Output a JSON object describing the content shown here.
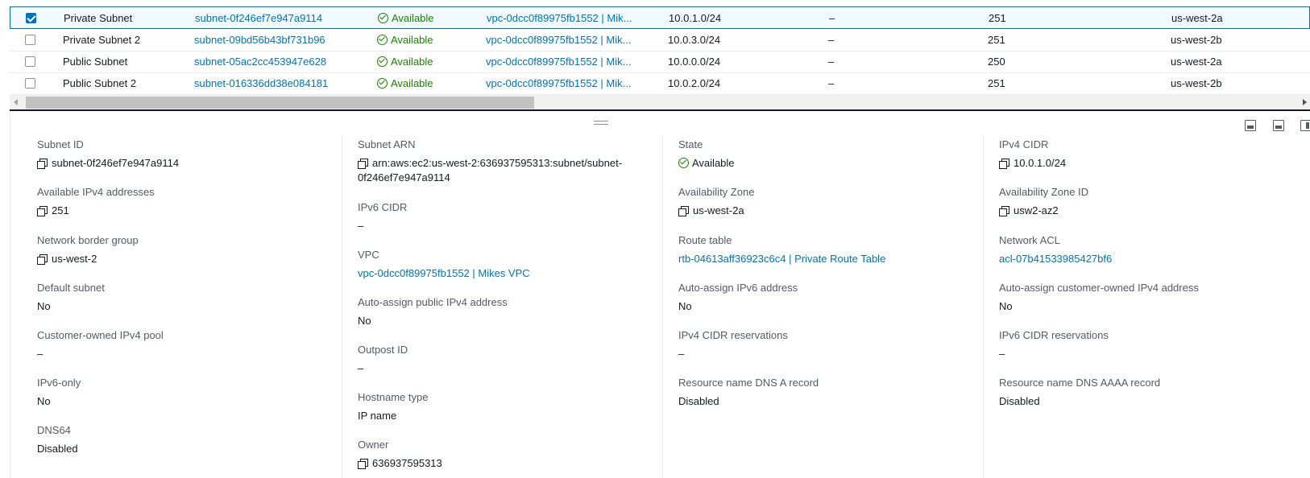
{
  "table": {
    "rows": [
      {
        "name": "Private Subnet",
        "subnet_id": "subnet-0f246ef7e947a9114",
        "state": "Available",
        "vpc": "vpc-0dcc0f89975fb1552 | Mik...",
        "cidr": "10.0.1.0/24",
        "ipv6": "–",
        "available_ips": "251",
        "az": "us-west-2a",
        "selected": true
      },
      {
        "name": "Private Subnet 2",
        "subnet_id": "subnet-09bd56b43bf731b96",
        "state": "Available",
        "vpc": "vpc-0dcc0f89975fb1552 | Mik...",
        "cidr": "10.0.3.0/24",
        "ipv6": "–",
        "available_ips": "251",
        "az": "us-west-2b",
        "selected": false
      },
      {
        "name": "Public Subnet",
        "subnet_id": "subnet-05ac2cc453947e628",
        "state": "Available",
        "vpc": "vpc-0dcc0f89975fb1552 | Mik...",
        "cidr": "10.0.0.0/24",
        "ipv6": "–",
        "available_ips": "250",
        "az": "us-west-2a",
        "selected": false
      },
      {
        "name": "Public Subnet 2",
        "subnet_id": "subnet-016336dd38e084181",
        "state": "Available",
        "vpc": "vpc-0dcc0f89975fb1552 | Mik...",
        "cidr": "10.0.2.0/24",
        "ipv6": "–",
        "available_ips": "251",
        "az": "us-west-2b",
        "selected": false
      }
    ]
  },
  "details": {
    "col1": [
      {
        "label": "Subnet ID",
        "value": "subnet-0f246ef7e947a9114",
        "copy": true
      },
      {
        "label": "Available IPv4 addresses",
        "value": "251",
        "copy": true
      },
      {
        "label": "Network border group",
        "value": "us-west-2",
        "copy": true
      },
      {
        "label": "Default subnet",
        "value": "No"
      },
      {
        "label": "Customer-owned IPv4 pool",
        "value": "–"
      },
      {
        "label": "IPv6-only",
        "value": "No"
      },
      {
        "label": "DNS64",
        "value": "Disabled"
      }
    ],
    "col2": [
      {
        "label": "Subnet ARN",
        "value": "arn:aws:ec2:us-west-2:636937595313:subnet/subnet-",
        "value2": "0f246ef7e947a9114",
        "copy": true
      },
      {
        "label": "IPv6 CIDR",
        "value": "–"
      },
      {
        "label": "VPC",
        "value": "vpc-0dcc0f89975fb1552 | Mikes VPC",
        "link": true
      },
      {
        "label": "Auto-assign public IPv4 address",
        "value": "No"
      },
      {
        "label": "Outpost ID",
        "value": "–"
      },
      {
        "label": "Hostname type",
        "value": "IP name"
      },
      {
        "label": "Owner",
        "value": "636937595313",
        "copy": true
      }
    ],
    "col3": [
      {
        "label": "State",
        "value": "Available",
        "status": true
      },
      {
        "label": "Availability Zone",
        "value": "us-west-2a",
        "copy": true
      },
      {
        "label": "Route table",
        "value": "rtb-04613aff36923c6c4 | Private Route Table",
        "link": true
      },
      {
        "label": "Auto-assign IPv6 address",
        "value": "No"
      },
      {
        "label": "IPv4 CIDR reservations",
        "value": "–"
      },
      {
        "label": "Resource name DNS A record",
        "value": "Disabled"
      }
    ],
    "col4": [
      {
        "label": "IPv4 CIDR",
        "value": "10.0.1.0/24",
        "copy": true
      },
      {
        "label": "Availability Zone ID",
        "value": "usw2-az2",
        "copy": true
      },
      {
        "label": "Network ACL",
        "value": "acl-07b41533985427bf6",
        "link": true
      },
      {
        "label": "Auto-assign customer-owned IPv4 address",
        "value": "No"
      },
      {
        "label": "IPv6 CIDR reservations",
        "value": "–"
      },
      {
        "label": "Resource name DNS AAAA record",
        "value": "Disabled"
      }
    ]
  }
}
